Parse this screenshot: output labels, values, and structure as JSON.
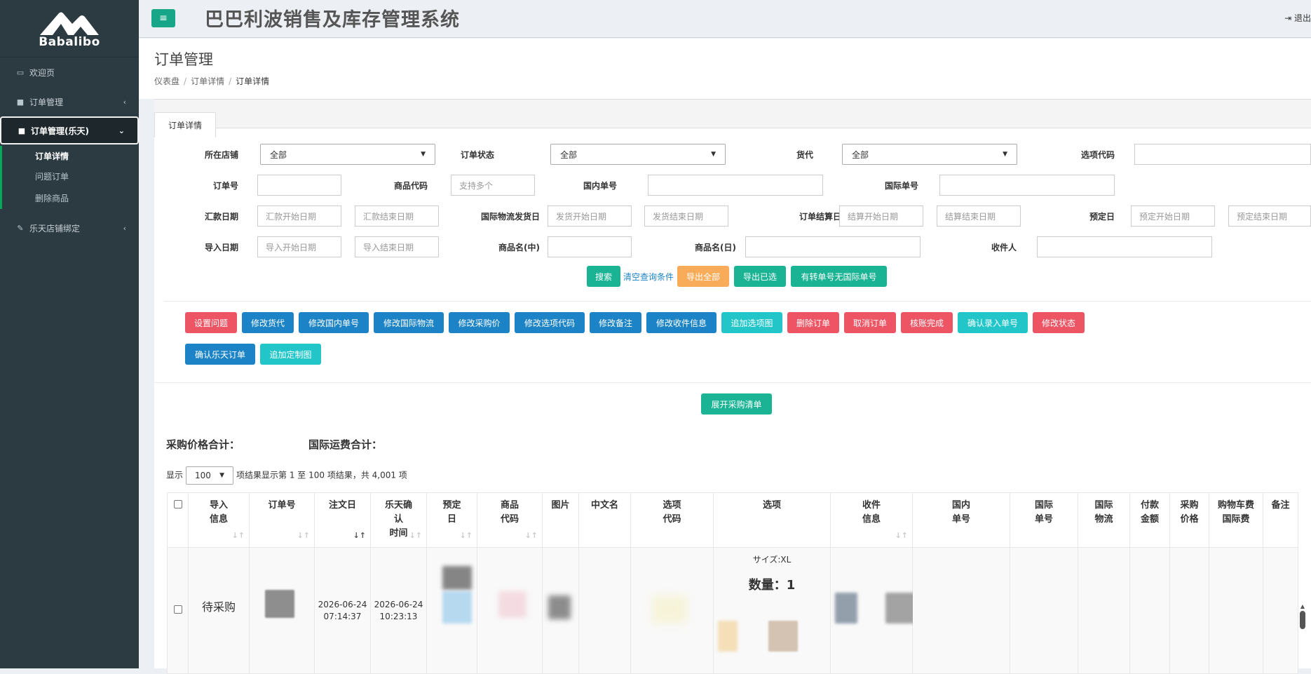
{
  "brand": {
    "name": "Babalibo"
  },
  "header": {
    "title": "巴巴利波销售及库存管理系统",
    "logout": "退出"
  },
  "sidebar": {
    "items": [
      {
        "label": "欢迎页",
        "icon": "monitor-icon"
      },
      {
        "label": "订单管理",
        "icon": "bookmark-icon"
      },
      {
        "label": "订单管理(乐天)",
        "icon": "bookmark-icon"
      },
      {
        "label": "乐天店铺绑定",
        "icon": "edit-icon"
      }
    ],
    "sub_items": [
      "订单详情",
      "问题订单",
      "删除商品"
    ]
  },
  "page": {
    "title": "订单管理",
    "breadcrumb": [
      "仪表盘",
      "订单详情",
      "订单详情"
    ],
    "tab": "订单详情"
  },
  "filters": {
    "store_label": "所在店铺",
    "store_value": "全部",
    "status_label": "订单状态",
    "status_value": "全部",
    "forwarder_label": "货代",
    "forwarder_value": "全部",
    "option_code_label": "选项代码",
    "order_no_label": "订单号",
    "product_code_label": "商品代码",
    "product_code_placeholder": "支持多个",
    "domestic_no_label": "国内单号",
    "intl_no_label": "国际单号",
    "remit_date_label": "汇款日期",
    "remit_start": "汇款开始日期",
    "remit_end": "汇款结束日期",
    "ship_date_label": "国际物流发货日",
    "ship_start": "发货开始日期",
    "ship_end": "发货结束日期",
    "settle_date_label": "订单结算日",
    "settle_start": "结算开始日期",
    "settle_end": "结算结束日期",
    "reserve_label": "预定日",
    "reserve_start": "预定开始日期",
    "reserve_end": "预定结束日期",
    "import_date_label": "导入日期",
    "import_start": "导入开始日期",
    "import_end": "导入结束日期",
    "name_cn_label": "商品名(中)",
    "name_jp_label": "商品名(日)",
    "recipient_label": "收件人"
  },
  "search_buttons": {
    "search": "搜索",
    "clear": "清空查询条件",
    "export_all": "导出全部",
    "export_selected": "导出已选",
    "export_transfer": "有转单号无国际单号"
  },
  "action_buttons": [
    "设置问题",
    "修改货代",
    "修改国内单号",
    "修改国际物流",
    "修改采购价",
    "修改选项代码",
    "修改备注",
    "修改收件信息",
    "追加选项图",
    "删除订单",
    "取消订单",
    "核账完成",
    "确认录入单号",
    "修改状态",
    "确认乐天订单",
    "追加定制图"
  ],
  "expand_button": "展开采购清单",
  "summary": {
    "purchase_total": "采购价格合计：",
    "intl_shipping_total": "国际运费合计："
  },
  "length": {
    "prefix": "显示",
    "value": "100",
    "info": "项结果显示第 1 至 100 项结果，共 4,001 项"
  },
  "table": {
    "headers": [
      "导入\n信息",
      "订单号",
      "注文日",
      "乐天确\n认\n时间",
      "预定\n日",
      "商品\n代码",
      "图片",
      "中文名",
      "选项\n代码",
      "选项",
      "收件\n信息",
      "国内\n单号",
      "国际\n单号",
      "国际\n物流",
      "付款\n金额",
      "采购\n价格",
      "购物车费\n国际费",
      "备注"
    ],
    "row": {
      "status": "待采购",
      "order_date": "2026-06-24\n07:14:37",
      "confirm_time": "2026-06-24\n10:23:13",
      "option_size": "サイズ:XL",
      "quantity": "数量：1"
    }
  },
  "colors": {
    "green": "#1ab394",
    "orange": "#f8ac59",
    "red": "#ed5565",
    "blue": "#1c84c6",
    "cyan": "#23c6c8",
    "sidebar": "#2c3b41"
  }
}
